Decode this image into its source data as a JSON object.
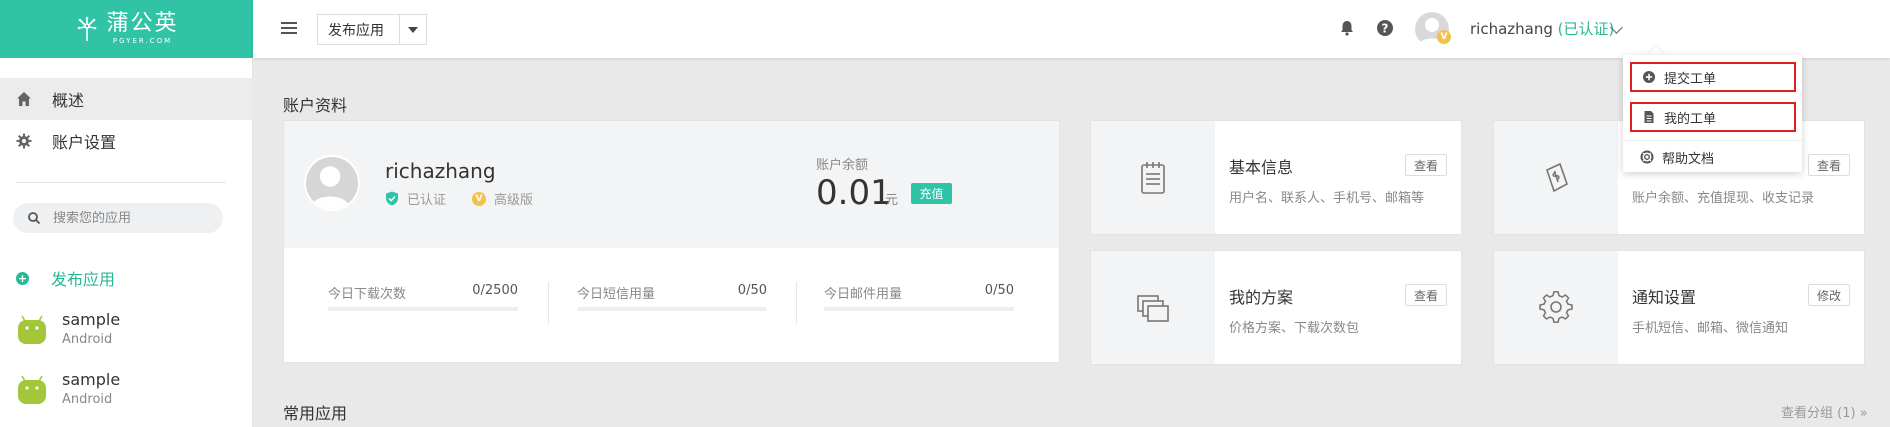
{
  "brand": {
    "name_cn": "蒲公英",
    "name_en": "PGYER.COM",
    "color": "#30c3a6"
  },
  "header": {
    "publish_label": "发布应用",
    "user_name": "richazhang",
    "verified_text": "(已认证)",
    "vip_badge": "V"
  },
  "dropdown": {
    "items": [
      {
        "label": "提交工单",
        "icon": "plus-circle-icon",
        "highlighted": true
      },
      {
        "label": "我的工单",
        "icon": "document-icon",
        "highlighted": true
      },
      {
        "label": "帮助文档",
        "icon": "lifebuoy-icon",
        "highlighted": false
      }
    ]
  },
  "sidebar": {
    "items": [
      {
        "label": "概述",
        "icon": "home-icon",
        "active": true
      },
      {
        "label": "账户设置",
        "icon": "gear-icon",
        "active": false
      }
    ],
    "search_placeholder": "搜索您的应用",
    "publish_link": "发布应用",
    "apps": [
      {
        "name": "sample",
        "platform": "Android"
      },
      {
        "name": "sample",
        "platform": "Android"
      }
    ]
  },
  "main": {
    "section_title": "账户资料",
    "profile": {
      "name": "richazhang",
      "verified": "已认证",
      "vip_badge": "V",
      "plan": "高级版",
      "balance_label": "账户余额",
      "balance_value": "0.01",
      "balance_unit": "元",
      "recharge_label": "充值"
    },
    "stats": [
      {
        "label": "今日下载次数",
        "value": "0/2500",
        "progress": 0
      },
      {
        "label": "今日短信用量",
        "value": "0/50",
        "progress": 0
      },
      {
        "label": "今日邮件用量",
        "value": "0/50",
        "progress": 0
      }
    ],
    "cards": [
      {
        "title": "基本信息",
        "desc": "用户名、联系人、手机号、邮箱等",
        "button": "查看",
        "icon": "notepad-icon"
      },
      {
        "title": "",
        "desc": "账户余额、充值提现、收支记录",
        "button": "查看",
        "icon": "money-note-icon"
      },
      {
        "title": "我的方案",
        "desc": "价格方案、下载次数包",
        "button": "查看",
        "icon": "stacked-windows-icon"
      },
      {
        "title": "通知设置",
        "desc": "手机短信、邮箱、微信通知",
        "button": "修改",
        "icon": "gear-icon"
      }
    ],
    "common_apps_title": "常用应用",
    "view_groups": "查看分组 (1)",
    "view_groups_arrow": "»"
  }
}
